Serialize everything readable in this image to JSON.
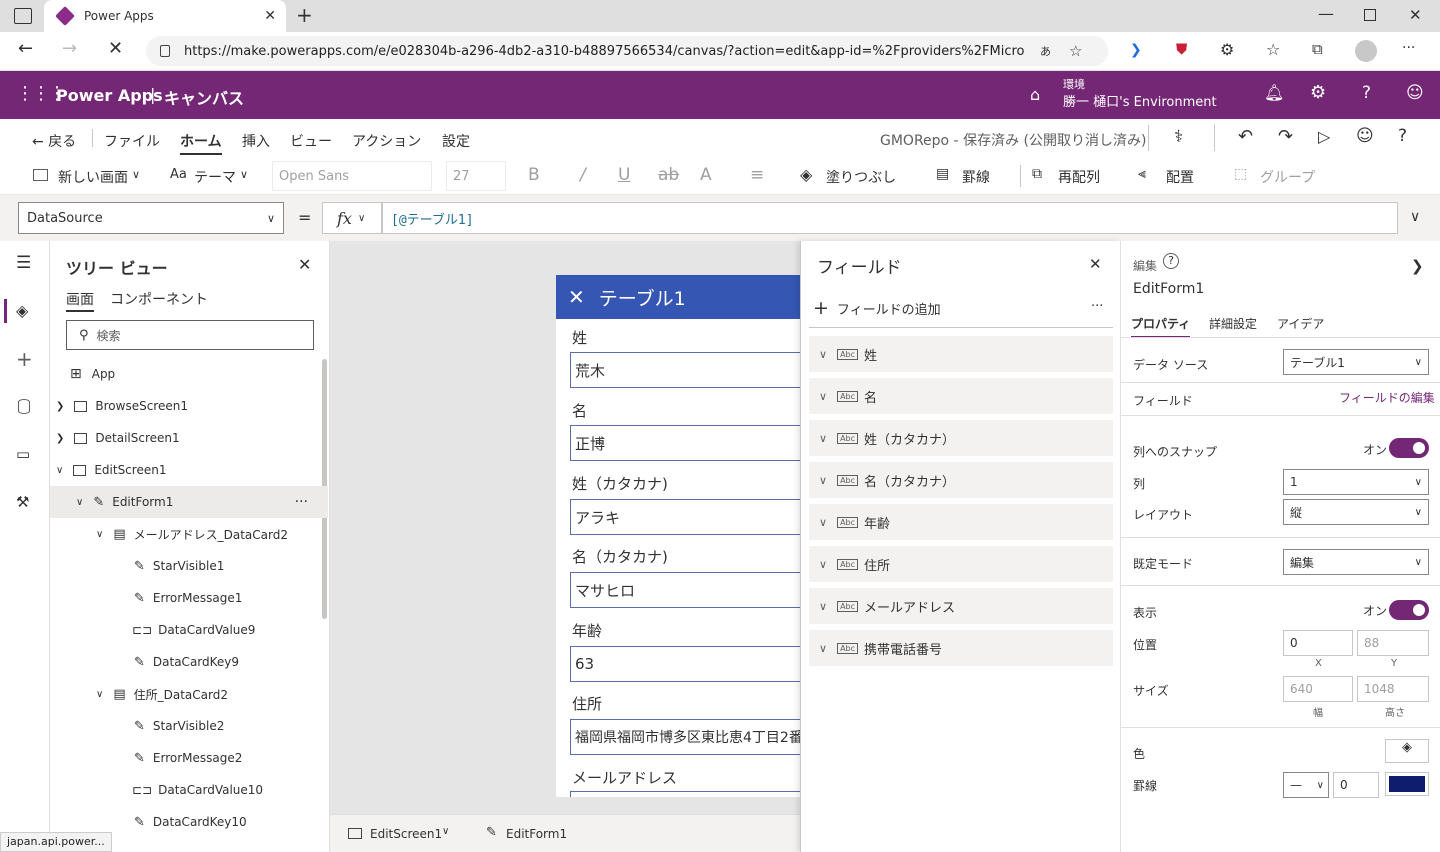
{
  "browser": {
    "tab_title": "Power Apps",
    "url": "https://make.powerapps.com/e/e028304b-a296-4db2-a310-b48897566534/canvas/?action=edit&app-id=%2Fproviders%2FMicrosoft....",
    "status_url": "japan.api.power..."
  },
  "header": {
    "app": "Power Apps",
    "divider": "|",
    "section": "キャンバス",
    "env_label": "環境",
    "env_name": "勝一 樋口's Environment"
  },
  "menu": {
    "back": "戻る",
    "items": [
      "ファイル",
      "ホーム",
      "挿入",
      "ビュー",
      "アクション",
      "設定"
    ],
    "save_status": "GMORepo - 保存済み (公開取り消し済み)"
  },
  "ribbon": {
    "new_screen": "新しい画面",
    "theme": "テーマ",
    "font": "Open Sans",
    "size": "27",
    "fill": "塗りつぶし",
    "border": "罫線",
    "reorder": "再配列",
    "align": "配置",
    "group": "グループ"
  },
  "formula": {
    "property": "DataSource",
    "eq": "=",
    "fx": "fx",
    "value": "[@テーブル1]"
  },
  "tree": {
    "title": "ツリー ビュー",
    "tab_screen": "画面",
    "tab_component": "コンポーネント",
    "search_placeholder": "検索",
    "nodes": [
      "App",
      "BrowseScreen1",
      "DetailScreen1",
      "EditScreen1",
      "EditForm1",
      "メールアドレス_DataCard2",
      "StarVisible1",
      "ErrorMessage1",
      "DataCardValue9",
      "DataCardKey9",
      "住所_DataCard2",
      "StarVisible2",
      "ErrorMessage2",
      "DataCardValue10",
      "DataCardKey10"
    ]
  },
  "form": {
    "title": "テーブル1",
    "fields": [
      {
        "label": "姓",
        "value": "荒木"
      },
      {
        "label": "名",
        "value": "正博"
      },
      {
        "label": "姓（カタカナ)",
        "value": "アラキ"
      },
      {
        "label": "名（カタカナ)",
        "value": "マサヒロ"
      },
      {
        "label": "年齢",
        "value": "63"
      },
      {
        "label": "住所",
        "value": "福岡県福岡市博多区東比恵4丁目2番"
      },
      {
        "label": "メールアドレス",
        "value": ""
      }
    ]
  },
  "fields_panel": {
    "title": "フィールド",
    "add": "フィールドの追加",
    "more": "···",
    "items": [
      "姓",
      "名",
      "姓（カタカナ）",
      "名（カタカナ）",
      "年齢",
      "住所",
      "メールアドレス",
      "携帯電話番号"
    ],
    "type_badge": "Abc"
  },
  "props": {
    "section": "編集",
    "name": "EditForm1",
    "tabs": [
      "プロパティ",
      "詳細設定",
      "アイデア"
    ],
    "datasource_label": "データ ソース",
    "datasource_value": "テーブル1",
    "fields_label": "フィールド",
    "fields_link": "フィールドの編集",
    "snap_label": "列へのスナップ",
    "snap_state": "オン",
    "columns_label": "列",
    "columns_value": "1",
    "layout_label": "レイアウト",
    "layout_value": "縦",
    "mode_label": "既定モード",
    "mode_value": "編集",
    "visible_label": "表示",
    "visible_state": "オン",
    "position_label": "位置",
    "x": "0",
    "y": "88",
    "x_cap": "X",
    "y_cap": "Y",
    "size_label": "サイズ",
    "w": "640",
    "h": "1048",
    "w_cap": "幅",
    "h_cap": "高さ",
    "color_label": "色",
    "border_label": "罫線",
    "border_width": "0",
    "border_color": "#0f1d6e"
  },
  "bottom": {
    "screen": "EditScreen1",
    "form": "EditForm1"
  },
  "colors": {
    "brand": "#742774",
    "accent": "#3557b3",
    "toggle": "#742774"
  }
}
